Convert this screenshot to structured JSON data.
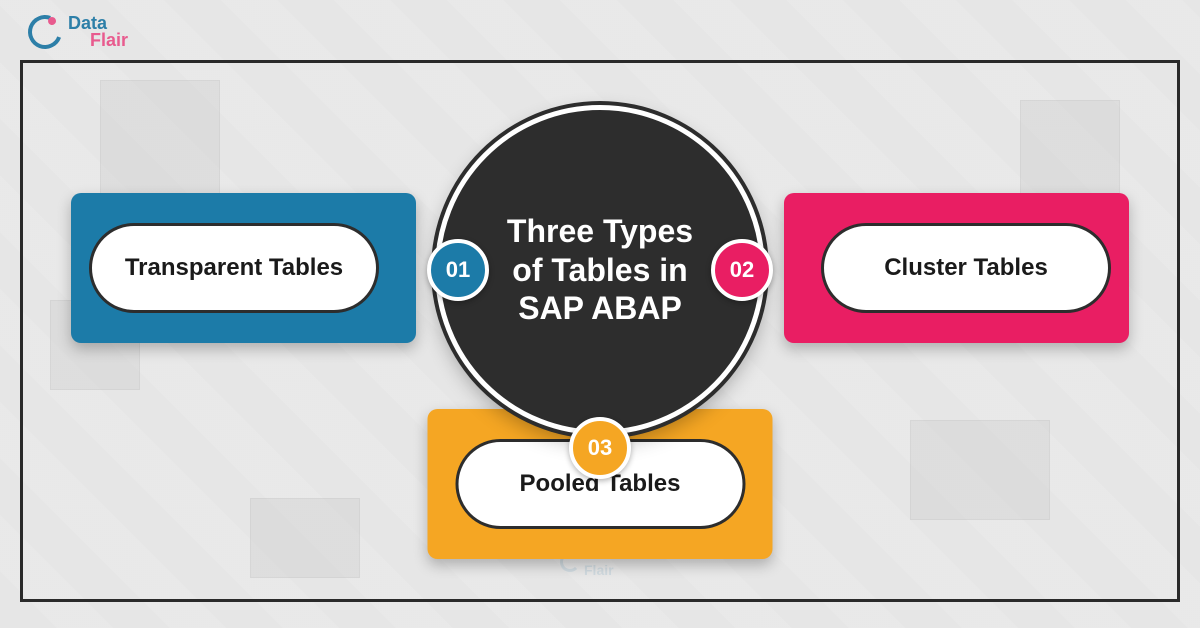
{
  "logo": {
    "line1": "Data",
    "line2": "Flair"
  },
  "center": {
    "line1": "Three Types",
    "line2": "of Tables in",
    "line3": "SAP ABAP"
  },
  "items": [
    {
      "num": "01",
      "label": "Transparent Tables",
      "color": "#1c7ba8"
    },
    {
      "num": "02",
      "label": "Cluster Tables",
      "color": "#e91e63"
    },
    {
      "num": "03",
      "label": "Pooled Tables",
      "color": "#f5a623"
    }
  ],
  "chart_data": {
    "type": "diagram",
    "title": "Three Types of Tables in SAP ABAP",
    "nodes": [
      {
        "id": "01",
        "label": "Transparent Tables"
      },
      {
        "id": "02",
        "label": "Cluster Tables"
      },
      {
        "id": "03",
        "label": "Pooled Tables"
      }
    ]
  }
}
